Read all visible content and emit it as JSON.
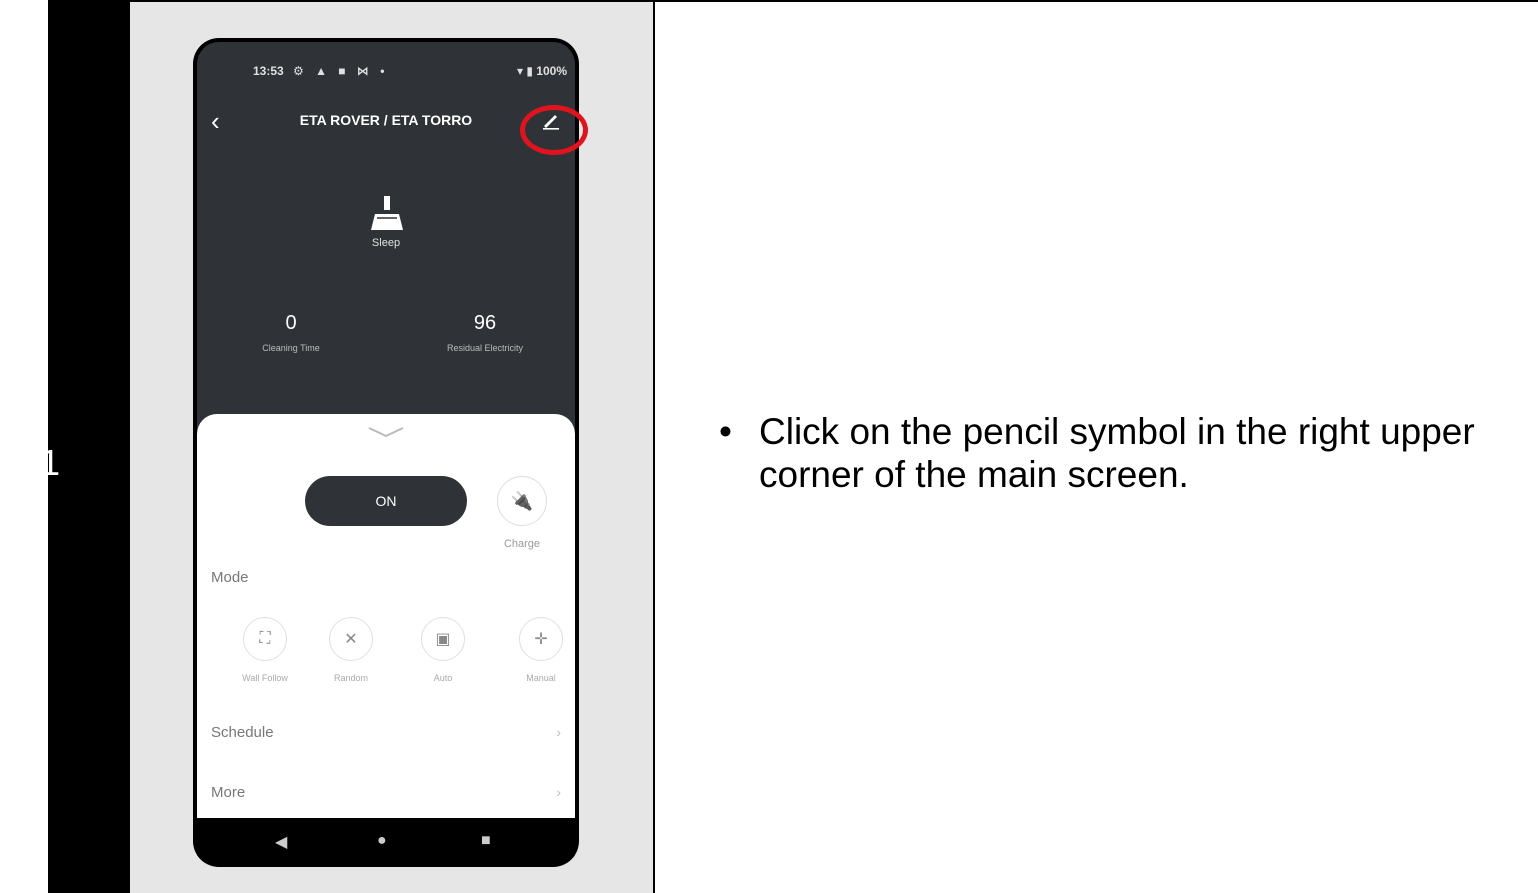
{
  "step": {
    "number": "1"
  },
  "instruction": {
    "bullet": "•",
    "text": "Click on the pencil symbol in the right upper corner of the main screen."
  },
  "phone": {
    "status_bar": {
      "time": "13:53",
      "icons": "⚙ ▲ ■ ⋈ •",
      "right": "▾ ▮ 100%"
    },
    "header": {
      "back": "‹",
      "title": "ETA ROVER / ETA TORRO",
      "edit_icon": "pencil-icon"
    },
    "state_label": "Sleep",
    "stats": [
      {
        "value": "0",
        "label": "Cleaning Time"
      },
      {
        "value": "96",
        "label": "Residual Electricity"
      }
    ],
    "power_button": "ON",
    "charge": {
      "icon": "plug-icon",
      "label": "Charge"
    },
    "mode_title": "Mode",
    "modes": [
      {
        "icon": "wall-follow-icon",
        "glyph": "⛶",
        "label": "Wall Follow"
      },
      {
        "icon": "random-icon",
        "glyph": "✕",
        "label": "Random"
      },
      {
        "icon": "auto-icon",
        "glyph": "▣",
        "label": "Auto"
      },
      {
        "icon": "manual-icon",
        "glyph": "✛",
        "label": "Manual"
      }
    ],
    "rows": [
      {
        "label": "Schedule",
        "arrow": "›"
      },
      {
        "label": "More",
        "arrow": "›"
      }
    ],
    "nav": {
      "back": "◀",
      "home": "●",
      "recent": "■"
    }
  },
  "colors": {
    "highlight": "#e0141e",
    "header_bg": "#2f3337",
    "panel_bg": "#e6e6e6"
  }
}
